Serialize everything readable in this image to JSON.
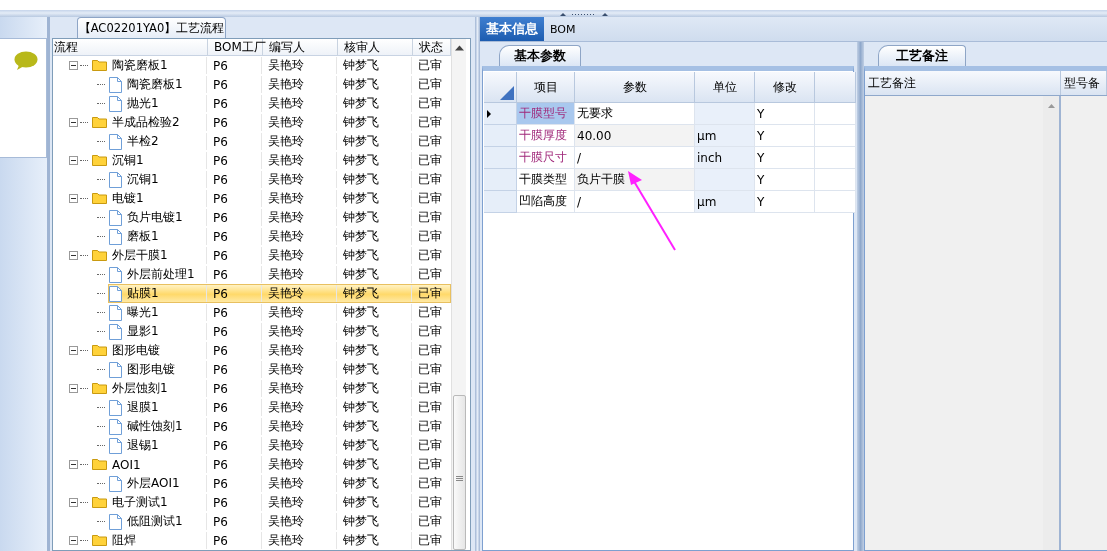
{
  "tree_panel": {
    "title": "【AC02201YA0】工艺流程",
    "columns": [
      "流程",
      "BOM工厂",
      "编写人",
      "核审人",
      "状态"
    ],
    "rows": [
      {
        "name": "陶瓷磨板1",
        "kind": "folder",
        "expanded": true,
        "selected": false,
        "bom_plant": "P6",
        "writer": "吴艳玲",
        "reviewer": "钟梦飞",
        "status": "已审",
        "children": [
          {
            "name": "陶瓷磨板1",
            "kind": "file",
            "selected": false,
            "bom_plant": "P6",
            "writer": "吴艳玲",
            "reviewer": "钟梦飞",
            "status": "已审"
          },
          {
            "name": "抛光1",
            "kind": "file",
            "selected": false,
            "bom_plant": "P6",
            "writer": "吴艳玲",
            "reviewer": "钟梦飞",
            "status": "已审"
          }
        ]
      },
      {
        "name": "半成品检验2",
        "kind": "folder",
        "expanded": true,
        "selected": false,
        "bom_plant": "P6",
        "writer": "吴艳玲",
        "reviewer": "钟梦飞",
        "status": "已审",
        "children": [
          {
            "name": "半检2",
            "kind": "file",
            "selected": false,
            "bom_plant": "P6",
            "writer": "吴艳玲",
            "reviewer": "钟梦飞",
            "status": "已审"
          }
        ]
      },
      {
        "name": "沉铜1",
        "kind": "folder",
        "expanded": true,
        "selected": false,
        "bom_plant": "P6",
        "writer": "吴艳玲",
        "reviewer": "钟梦飞",
        "status": "已审",
        "children": [
          {
            "name": "沉铜1",
            "kind": "file",
            "selected": false,
            "bom_plant": "P6",
            "writer": "吴艳玲",
            "reviewer": "钟梦飞",
            "status": "已审"
          }
        ]
      },
      {
        "name": "电镀1",
        "kind": "folder",
        "expanded": true,
        "selected": false,
        "bom_plant": "P6",
        "writer": "吴艳玲",
        "reviewer": "钟梦飞",
        "status": "已审",
        "children": [
          {
            "name": "负片电镀1",
            "kind": "file",
            "selected": false,
            "bom_plant": "P6",
            "writer": "吴艳玲",
            "reviewer": "钟梦飞",
            "status": "已审"
          },
          {
            "name": "磨板1",
            "kind": "file",
            "selected": false,
            "bom_plant": "P6",
            "writer": "吴艳玲",
            "reviewer": "钟梦飞",
            "status": "已审"
          }
        ]
      },
      {
        "name": "外层干膜1",
        "kind": "folder",
        "expanded": true,
        "selected": false,
        "bom_plant": "P6",
        "writer": "吴艳玲",
        "reviewer": "钟梦飞",
        "status": "已审",
        "children": [
          {
            "name": "外层前处理1",
            "kind": "file",
            "selected": false,
            "bom_plant": "P6",
            "writer": "吴艳玲",
            "reviewer": "钟梦飞",
            "status": "已审"
          },
          {
            "name": "贴膜1",
            "kind": "file",
            "selected": true,
            "bom_plant": "P6",
            "writer": "吴艳玲",
            "reviewer": "钟梦飞",
            "status": "已审"
          },
          {
            "name": "曝光1",
            "kind": "file",
            "selected": false,
            "bom_plant": "P6",
            "writer": "吴艳玲",
            "reviewer": "钟梦飞",
            "status": "已审"
          },
          {
            "name": "显影1",
            "kind": "file",
            "selected": false,
            "bom_plant": "P6",
            "writer": "吴艳玲",
            "reviewer": "钟梦飞",
            "status": "已审"
          }
        ]
      },
      {
        "name": "图形电镀",
        "kind": "folder",
        "expanded": true,
        "selected": false,
        "bom_plant": "P6",
        "writer": "吴艳玲",
        "reviewer": "钟梦飞",
        "status": "已审",
        "children": [
          {
            "name": "图形电镀",
            "kind": "file",
            "selected": false,
            "bom_plant": "P6",
            "writer": "吴艳玲",
            "reviewer": "钟梦飞",
            "status": "已审"
          }
        ]
      },
      {
        "name": "外层蚀刻1",
        "kind": "folder",
        "expanded": true,
        "selected": false,
        "bom_plant": "P6",
        "writer": "吴艳玲",
        "reviewer": "钟梦飞",
        "status": "已审",
        "children": [
          {
            "name": "退膜1",
            "kind": "file",
            "selected": false,
            "bom_plant": "P6",
            "writer": "吴艳玲",
            "reviewer": "钟梦飞",
            "status": "已审"
          },
          {
            "name": "碱性蚀刻1",
            "kind": "file",
            "selected": false,
            "bom_plant": "P6",
            "writer": "吴艳玲",
            "reviewer": "钟梦飞",
            "status": "已审"
          },
          {
            "name": "退锡1",
            "kind": "file",
            "selected": false,
            "bom_plant": "P6",
            "writer": "吴艳玲",
            "reviewer": "钟梦飞",
            "status": "已审"
          }
        ]
      },
      {
        "name": "AOI1",
        "kind": "folder",
        "expanded": true,
        "selected": false,
        "bom_plant": "P6",
        "writer": "吴艳玲",
        "reviewer": "钟梦飞",
        "status": "已审",
        "children": [
          {
            "name": "外层AOI1",
            "kind": "file",
            "selected": false,
            "bom_plant": "P6",
            "writer": "吴艳玲",
            "reviewer": "钟梦飞",
            "status": "已审"
          }
        ]
      },
      {
        "name": "电子测试1",
        "kind": "folder",
        "expanded": true,
        "selected": false,
        "bom_plant": "P6",
        "writer": "吴艳玲",
        "reviewer": "钟梦飞",
        "status": "已审",
        "children": [
          {
            "name": "低阻测试1",
            "kind": "file",
            "selected": false,
            "bom_plant": "P6",
            "writer": "吴艳玲",
            "reviewer": "钟梦飞",
            "status": "已审"
          }
        ]
      },
      {
        "name": "阻焊",
        "kind": "folder",
        "expanded": true,
        "selected": false,
        "bom_plant": "P6",
        "writer": "吴艳玲",
        "reviewer": "钟梦飞",
        "status": "已审"
      }
    ]
  },
  "tabs": [
    {
      "label": "基本信息",
      "selected": true
    },
    {
      "label": "BOM",
      "selected": false
    }
  ],
  "params_panel": {
    "tab": "基本参数",
    "columns": [
      "项目",
      "参数",
      "单位",
      "修改"
    ],
    "rows": [
      {
        "item": "干膜型号",
        "highlighted": true,
        "value": "无要求",
        "modified": "Y",
        "current": true
      },
      {
        "item": "干膜厚度",
        "highlighted": true,
        "value": "40.00",
        "unit": "μm",
        "modified": "Y",
        "current": false
      },
      {
        "item": "干膜尺寸",
        "highlighted": true,
        "value": "/",
        "unit": "inch",
        "modified": "Y",
        "current": false
      },
      {
        "item": "干膜类型",
        "highlighted": false,
        "value": "负片干膜",
        "modified": "Y",
        "current": false
      },
      {
        "item": "凹陷高度",
        "highlighted": false,
        "value": "/",
        "unit": "μm",
        "modified": "Y",
        "current": false
      }
    ]
  },
  "notes_panel": {
    "tab": "工艺备注",
    "columns": [
      "工艺备注",
      "型号备"
    ]
  }
}
